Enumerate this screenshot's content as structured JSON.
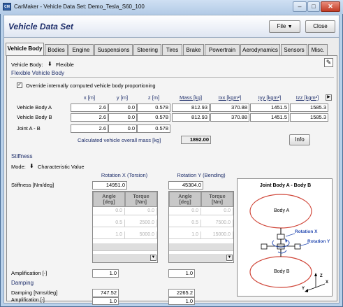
{
  "window": {
    "title": "CarMaker - Vehicle Data Set: Demo_Tesla_S60_100",
    "app_icon": "CM",
    "minimize": "–",
    "maximize": "□",
    "close": "✕"
  },
  "header": {
    "title": "Vehicle Data Set",
    "file_button": "File",
    "close_button": "Close"
  },
  "tabs": [
    "Vehicle Body",
    "Bodies",
    "Engine",
    "Suspensions",
    "Steering",
    "Tires",
    "Brake",
    "Powertrain",
    "Aerodynamics",
    "Sensors",
    "Misc."
  ],
  "active_tab": "Vehicle Body",
  "vehicle_body": {
    "label": "Vehicle Body:",
    "value": "Flexible",
    "section_title": "Flexible Vehicle Body",
    "override_label": "Override internally computed vehicle body proportioning",
    "override_checked": "✓",
    "col_headers": [
      "x [m]",
      "y [m]",
      "z [m]",
      "Mass [kg]",
      "Ixx [kgm²]",
      "Iyy [kgm²]",
      "Izz [kgm²]"
    ],
    "rows": [
      {
        "name": "Vehicle Body A",
        "values": [
          "2.6",
          "0.0",
          "0.578",
          "812.93",
          "370.88",
          "1451.5",
          "1585.3"
        ]
      },
      {
        "name": "Vehicle Body B",
        "values": [
          "2.6",
          "0.0",
          "0.578",
          "812.93",
          "370.88",
          "1451.5",
          "1585.3"
        ]
      },
      {
        "name": "Joint A - B",
        "values": [
          "2.6",
          "0.0",
          "0.578"
        ]
      }
    ],
    "mass_label": "Calculated vehicle overall mass [kg]",
    "mass_value": "1892.00",
    "info_button": "Info"
  },
  "stiffness": {
    "section_title": "Stiffness",
    "mode_label": "Mode:",
    "mode_value": "Characteristic Value",
    "rot_x_title": "Rotation X (Torsion)",
    "rot_y_title": "Rotation Y (Bending)",
    "stiffness_label": "Stiffness [Nm/deg]",
    "stiffness_x": "14951.0",
    "stiffness_y": "45304.0",
    "col_angle": "Angle\n[deg]",
    "col_torque": "Torque\n[Nm]",
    "table_x": [
      [
        "0.0",
        "0.0"
      ],
      [
        "0.5",
        "2500.0"
      ],
      [
        "1.0",
        "5000.0"
      ]
    ],
    "table_y": [
      [
        "0.0",
        "0.0"
      ],
      [
        "0.5",
        "7500.0"
      ],
      [
        "1.0",
        "15000.0"
      ]
    ],
    "amplification_label": "Amplification [-]",
    "amplification_x": "1.0",
    "amplification_y": "1.0"
  },
  "damping": {
    "section_title": "Damping",
    "damping_label": "Damping [Nms/deg]",
    "damping_x": "747.52",
    "damping_y": "2265.2",
    "amplification_label": "Amplification [-]",
    "amplification_x": "1.0",
    "amplification_y": "1.0"
  },
  "diagram": {
    "title": "Joint Body A - Body B",
    "body_a": "Body A",
    "body_b": "Body B",
    "rotation_x": "Rotation X",
    "rotation_y": "Rotation Y",
    "axis_x": "X",
    "axis_y": "Y",
    "axis_z": "Z"
  },
  "icons": {
    "dropdown": "download-arrow-icon",
    "notes": "notepad-icon",
    "scroll_right": "arrow-right-icon",
    "scroll_down": "arrow-down-icon"
  }
}
